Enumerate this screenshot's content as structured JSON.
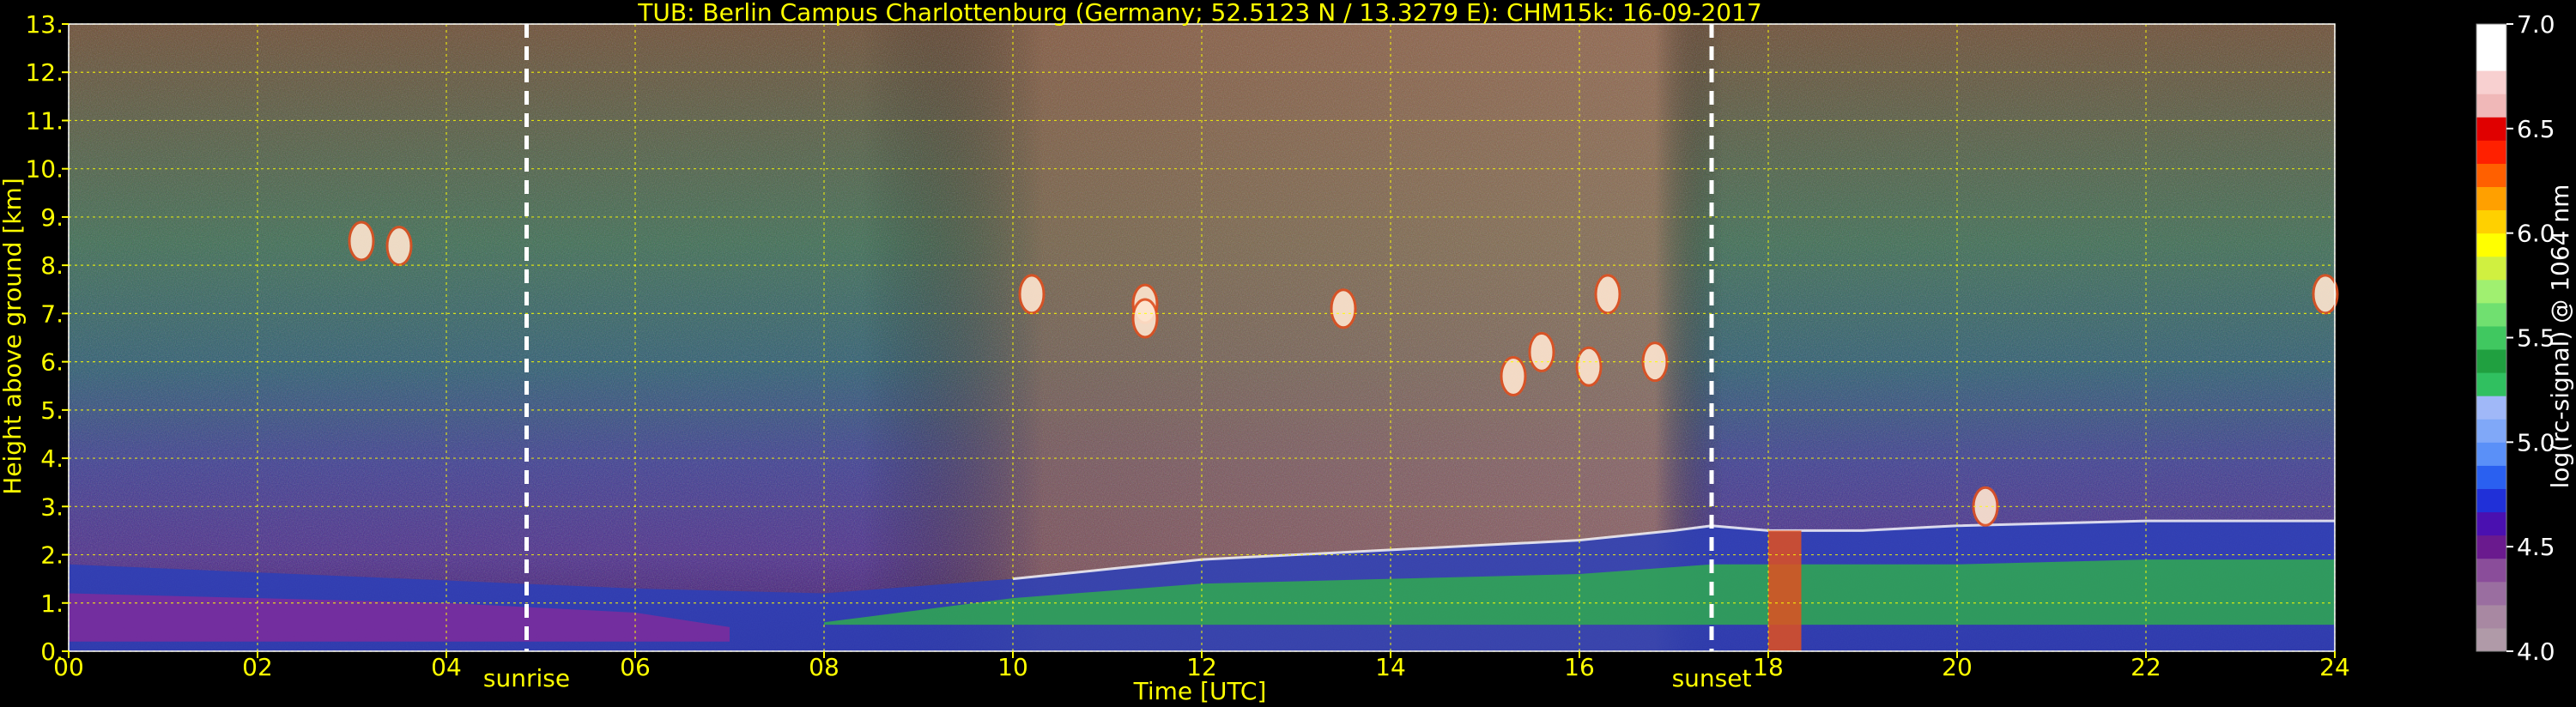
{
  "chart_data": {
    "type": "heatmap",
    "title": "TUB: Berlin Campus Charlottenburg (Germany; 52.5123 N / 13.3279 E):    CHM15k: 16-09-2017",
    "xlabel": "Time [UTC]",
    "ylabel": "Height above ground [km]",
    "xlim": [
      0,
      24
    ],
    "ylim": [
      0,
      13
    ],
    "x_ticks": [
      0,
      2,
      4,
      6,
      8,
      10,
      12,
      14,
      16,
      18,
      20,
      22,
      24
    ],
    "x_tick_labels": [
      "00",
      "02",
      "04",
      "06",
      "08",
      "10",
      "12",
      "14",
      "16",
      "18",
      "20",
      "22",
      "24"
    ],
    "y_ticks": [
      0,
      1,
      2,
      3,
      4,
      5,
      6,
      7,
      8,
      9,
      10,
      11,
      12,
      13
    ],
    "y_tick_labels": [
      "0.",
      "1.",
      "2.",
      "3.",
      "4.",
      "5.",
      "6.",
      "7.",
      "8.",
      "9.",
      "10.",
      "11.",
      "12.",
      "13."
    ],
    "grid": true,
    "markers": [
      {
        "label": "sunrise",
        "x": 4.85
      },
      {
        "label": "sunset",
        "x": 17.4
      }
    ],
    "colorbar": {
      "label": "log(rc-signal) @ 1064 nm",
      "range": [
        4.0,
        7.0
      ],
      "ticks": [
        4.0,
        4.5,
        5.0,
        5.5,
        6.0,
        6.5,
        7.0
      ],
      "tick_labels": [
        "4.0",
        "4.5",
        "5.0",
        "5.5",
        "6.0",
        "6.5",
        "7.0"
      ],
      "colors": [
        "#b09aa8",
        "#a888a2",
        "#9a6ea0",
        "#8a4d9a",
        "#6a1a8e",
        "#4a10b0",
        "#2030d8",
        "#2a60f0",
        "#5a90f8",
        "#80a8f8",
        "#a0b8f8",
        "#30c060",
        "#20a040",
        "#40c860",
        "#70e070",
        "#a0f070",
        "#d0f040",
        "#ffff00",
        "#ffd000",
        "#ffa000",
        "#ff6000",
        "#ff2000",
        "#e00000",
        "#f0b8b8",
        "#f8d0d0",
        "#ffffff",
        "#ffffff"
      ]
    },
    "layers": [
      {
        "name": "boundary_layer_top_km",
        "x": [
          0,
          6,
          8,
          10,
          11,
          12,
          13,
          14,
          15,
          16,
          17,
          17.4,
          18,
          19,
          20,
          22,
          24
        ],
        "y": [
          1.8,
          1.3,
          1.2,
          1.5,
          1.7,
          1.9,
          2.0,
          2.1,
          2.2,
          2.3,
          2.5,
          2.6,
          2.5,
          2.5,
          2.6,
          2.7,
          2.7
        ]
      },
      {
        "name": "cloud_patches",
        "points": [
          {
            "x": 3.1,
            "y": 8.5
          },
          {
            "x": 3.5,
            "y": 8.4
          },
          {
            "x": 10.2,
            "y": 7.4
          },
          {
            "x": 11.4,
            "y": 7.2
          },
          {
            "x": 11.4,
            "y": 6.9
          },
          {
            "x": 13.5,
            "y": 7.1
          },
          {
            "x": 15.3,
            "y": 5.7
          },
          {
            "x": 15.6,
            "y": 6.2
          },
          {
            "x": 16.1,
            "y": 5.9
          },
          {
            "x": 16.8,
            "y": 6.0
          },
          {
            "x": 16.3,
            "y": 7.4
          },
          {
            "x": 23.9,
            "y": 7.4
          },
          {
            "x": 20.3,
            "y": 3.0
          }
        ]
      }
    ]
  }
}
